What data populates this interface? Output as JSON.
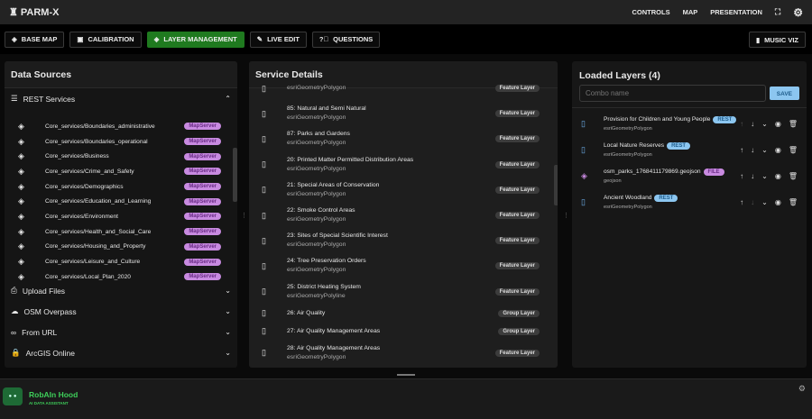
{
  "app": {
    "title": "PARM-X"
  },
  "topnav": {
    "controls": "CONTROLS",
    "map": "MAP",
    "presentation": "PRESENTATION"
  },
  "toolbar": {
    "base_map": "BASE MAP",
    "calibration": "CALIBRATION",
    "layer_management": "LAYER MANAGEMENT",
    "live_edit": "LIVE EDIT",
    "questions": "QUESTIONS",
    "music_viz": "MUSIC VIZ"
  },
  "data_sources": {
    "title": "Data Sources",
    "rest_services": "REST Services",
    "services": [
      {
        "name": "Core_services/Boundaries_administrative",
        "badge": "MapServer"
      },
      {
        "name": "Core_services/Boundaries_operational",
        "badge": "MapServer"
      },
      {
        "name": "Core_services/Business",
        "badge": "MapServer"
      },
      {
        "name": "Core_services/Crime_and_Safety",
        "badge": "MapServer"
      },
      {
        "name": "Core_services/Demographics",
        "badge": "MapServer"
      },
      {
        "name": "Core_services/Education_and_Learning",
        "badge": "MapServer"
      },
      {
        "name": "Core_services/Environment",
        "badge": "MapServer"
      },
      {
        "name": "Core_services/Health_and_Social_Care",
        "badge": "MapServer"
      },
      {
        "name": "Core_services/Housing_and_Property",
        "badge": "MapServer"
      },
      {
        "name": "Core_services/Leisure_and_Culture",
        "badge": "MapServer"
      },
      {
        "name": "Core_services/Local_Plan_2020",
        "badge": "MapServer"
      }
    ],
    "sections": [
      "Upload Files",
      "OSM Overpass",
      "From URL",
      "ArcGIS Online"
    ]
  },
  "service_details": {
    "title": "Service Details",
    "items": [
      {
        "title": "",
        "sub": "esriGeometryPolygon",
        "badge": "Feature Layer"
      },
      {
        "title": "85: Natural and Semi Natural",
        "sub": "esriGeometryPolygon",
        "badge": "Feature Layer"
      },
      {
        "title": "87: Parks and Gardens",
        "sub": "esriGeometryPolygon",
        "badge": "Feature Layer"
      },
      {
        "title": "20: Printed Matter Permitted Distribution Areas",
        "sub": "esriGeometryPolygon",
        "badge": "Feature Layer"
      },
      {
        "title": "21: Special Areas of Conservation",
        "sub": "esriGeometryPolygon",
        "badge": "Feature Layer"
      },
      {
        "title": "22: Smoke Control Areas",
        "sub": "esriGeometryPolygon",
        "badge": "Feature Layer"
      },
      {
        "title": "23: Sites of Special Scientific Interest",
        "sub": "esriGeometryPolygon",
        "badge": "Feature Layer"
      },
      {
        "title": "24: Tree Preservation Orders",
        "sub": "esriGeometryPolygon",
        "badge": "Feature Layer"
      },
      {
        "title": "25: District Heating System",
        "sub": "esriGeometryPolyline",
        "badge": "Feature Layer"
      },
      {
        "title": "26: Air Quality",
        "sub": "",
        "badge": "Group Layer"
      },
      {
        "title": "27: Air Quality Management Areas",
        "sub": "",
        "badge": "Group Layer"
      },
      {
        "title": "28: Air Quality Management Areas",
        "sub": "esriGeometryPolygon",
        "badge": "Feature Layer"
      }
    ]
  },
  "loaded_layers": {
    "title": "Loaded Layers (4)",
    "combo_placeholder": "Combo name",
    "save": "SAVE",
    "layers": [
      {
        "name": "Provision for Children and Young People",
        "type": "esriGeometryPolygon",
        "badge": "REST"
      },
      {
        "name": "Local Nature Reserves",
        "type": "esriGeometryPolygon",
        "badge": "REST"
      },
      {
        "name": "osm_parks_1768411179869.geojson",
        "type": "geojson",
        "badge": "FILE"
      },
      {
        "name": "Ancient Woodland",
        "type": "esriGeometryPolygon",
        "badge": "REST"
      }
    ]
  },
  "assistant": {
    "name": "RobAIn Hood",
    "subtitle": "AI DATA ASSISTANT"
  },
  "colors": {
    "accent_green": "#1f7a1f",
    "rest_badge": "#8cc6f0",
    "mapserver_badge": "#c88ae0",
    "assistant_green": "#3ecf5a"
  }
}
